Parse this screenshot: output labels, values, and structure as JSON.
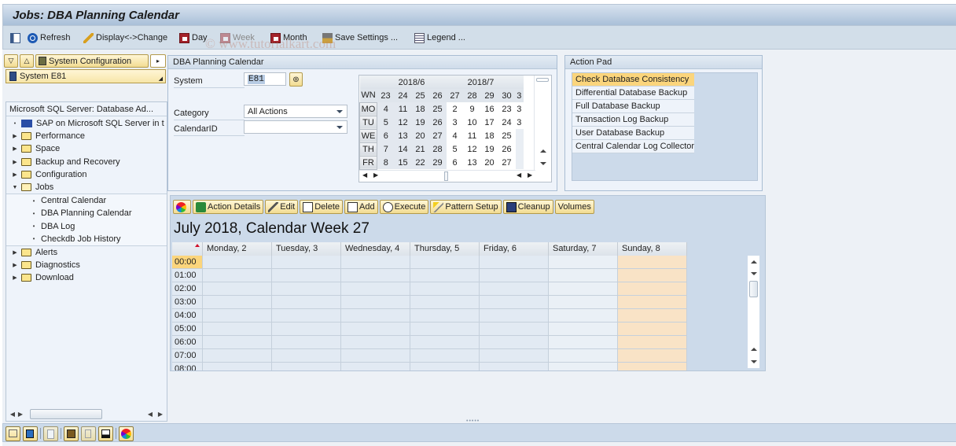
{
  "window": {
    "title": "Jobs: DBA Planning Calendar"
  },
  "toolbar": {
    "items": [
      {
        "label": "",
        "icon": "layout-icon"
      },
      {
        "label": "Refresh",
        "icon": "refresh-icon"
      },
      {
        "label": "Display<->Change",
        "icon": "pencil-icon"
      },
      {
        "label": "Day",
        "icon": "calendar-day-icon"
      },
      {
        "label": "Week",
        "icon": "calendar-week-icon"
      },
      {
        "label": "Month",
        "icon": "calendar-month-icon"
      },
      {
        "label": "Save Settings ...",
        "icon": "save-settings-icon"
      },
      {
        "label": "Legend ...",
        "icon": "legend-icon"
      }
    ],
    "watermark": "© www.tutorialkart.com"
  },
  "nav": {
    "system_config_label": "System Configuration",
    "system_field": "System E81",
    "tree_header": "Microsoft SQL Server: Database Ad...",
    "tree": [
      {
        "label": "SAP on Microsoft SQL Server in t",
        "type": "root"
      },
      {
        "label": "Performance",
        "type": "folder",
        "expanded": false
      },
      {
        "label": "Space",
        "type": "folder",
        "expanded": false
      },
      {
        "label": "Backup and Recovery",
        "type": "folder",
        "expanded": false
      },
      {
        "label": "Configuration",
        "type": "folder",
        "expanded": false
      },
      {
        "label": "Jobs",
        "type": "folder",
        "expanded": true
      },
      {
        "label": "Central Calendar",
        "type": "leaf"
      },
      {
        "label": "DBA Planning Calendar",
        "type": "leaf"
      },
      {
        "label": "DBA Log",
        "type": "leaf"
      },
      {
        "label": "Checkdb Job History",
        "type": "leaf"
      },
      {
        "label": "Alerts",
        "type": "folder",
        "expanded": false
      },
      {
        "label": "Diagnostics",
        "type": "folder",
        "expanded": false
      },
      {
        "label": "Download",
        "type": "folder",
        "expanded": false
      }
    ]
  },
  "planning": {
    "title": "DBA Planning Calendar",
    "system_label": "System",
    "system_value": "E81",
    "category_label": "Category",
    "category_value": "All Actions",
    "calendarid_label": "CalendarID",
    "calendarid_value": ""
  },
  "mini_calendar": {
    "months": [
      "2018/6",
      "2018/7"
    ],
    "wn_label": "WN",
    "weeks": [
      "23",
      "24",
      "25",
      "26",
      "27",
      "28",
      "29",
      "30",
      "3"
    ],
    "days": [
      "MO",
      "TU",
      "WE",
      "TH",
      "FR"
    ],
    "rows": [
      [
        "4",
        "11",
        "18",
        "25",
        "2",
        "9",
        "16",
        "23",
        "3"
      ],
      [
        "5",
        "12",
        "19",
        "26",
        "3",
        "10",
        "17",
        "24",
        "3"
      ],
      [
        "6",
        "13",
        "20",
        "27",
        "4",
        "11",
        "18",
        "25",
        ""
      ],
      [
        "7",
        "14",
        "21",
        "28",
        "5",
        "12",
        "19",
        "26",
        ""
      ],
      [
        "8",
        "15",
        "22",
        "29",
        "6",
        "13",
        "20",
        "27",
        ""
      ]
    ]
  },
  "action_pad": {
    "title": "Action Pad",
    "items": [
      "Check Database Consistency",
      "Differential Database Backup",
      "Full Database Backup",
      "Transaction Log Backup",
      "User Database Backup",
      "Central Calendar Log Collector"
    ],
    "selected_index": 0
  },
  "calendar": {
    "buttons": [
      {
        "label": "",
        "icon": "color-wheel-icon"
      },
      {
        "label": "Action Details",
        "icon": "action-details-icon"
      },
      {
        "label": "Edit",
        "icon": "pencil-icon"
      },
      {
        "label": "Delete",
        "icon": "trash-icon"
      },
      {
        "label": "Add",
        "icon": "page-icon"
      },
      {
        "label": "Execute",
        "icon": "clock-icon"
      },
      {
        "label": "Pattern Setup",
        "icon": "wand-icon"
      },
      {
        "label": "Cleanup",
        "icon": "cleanup-icon"
      },
      {
        "label": "Volumes",
        "icon": ""
      }
    ],
    "title": "July 2018, Calendar Week 27",
    "columns": [
      "Monday,  2",
      "Tuesday,  3",
      "Wednesday,  4",
      "Thursday,  5",
      "Friday,  6",
      "Saturday,  7",
      "Sunday,  8"
    ],
    "times": [
      "00:00",
      "01:00",
      "02:00",
      "03:00",
      "04:00",
      "05:00",
      "06:00",
      "07:00",
      "08:00"
    ],
    "current_time_index": 0
  },
  "bottom_toolbar": {
    "buttons": [
      "layout-icon",
      "filter-icon",
      "document-icon",
      "scroll-icon",
      "trash-icon",
      "print-icon",
      "color-wheel-icon"
    ]
  }
}
